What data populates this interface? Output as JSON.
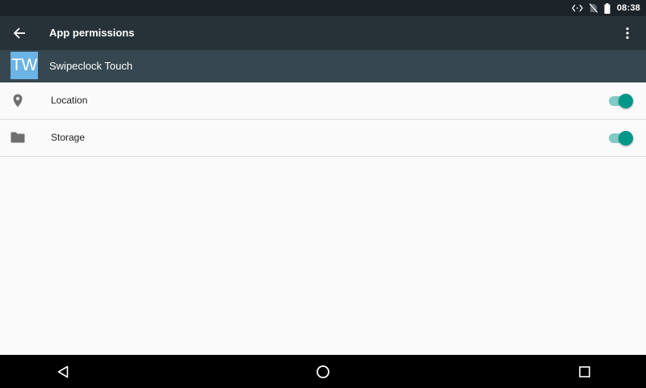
{
  "status_bar": {
    "time": "08:38",
    "icons": [
      "code-arrows-icon",
      "no-sim-icon",
      "battery-icon"
    ]
  },
  "toolbar": {
    "title": "App permissions",
    "back_icon": "arrow-back-icon",
    "overflow_icon": "more-vert-icon"
  },
  "app": {
    "icon_text": "TW",
    "name": "Swipeclock Touch",
    "icon_color": "#6cb3e6"
  },
  "permissions": [
    {
      "icon": "location-pin-icon",
      "label": "Location",
      "enabled": true
    },
    {
      "icon": "folder-icon",
      "label": "Storage",
      "enabled": true
    }
  ],
  "nav_bar": {
    "buttons": [
      "back-triangle-icon",
      "home-circle-icon",
      "recents-square-icon"
    ]
  },
  "colors": {
    "status_bar": "#1b2329",
    "toolbar": "#263238",
    "app_header": "#37474f",
    "accent": "#009688",
    "accent_track": "#80cbc4",
    "background": "#fafafa"
  }
}
